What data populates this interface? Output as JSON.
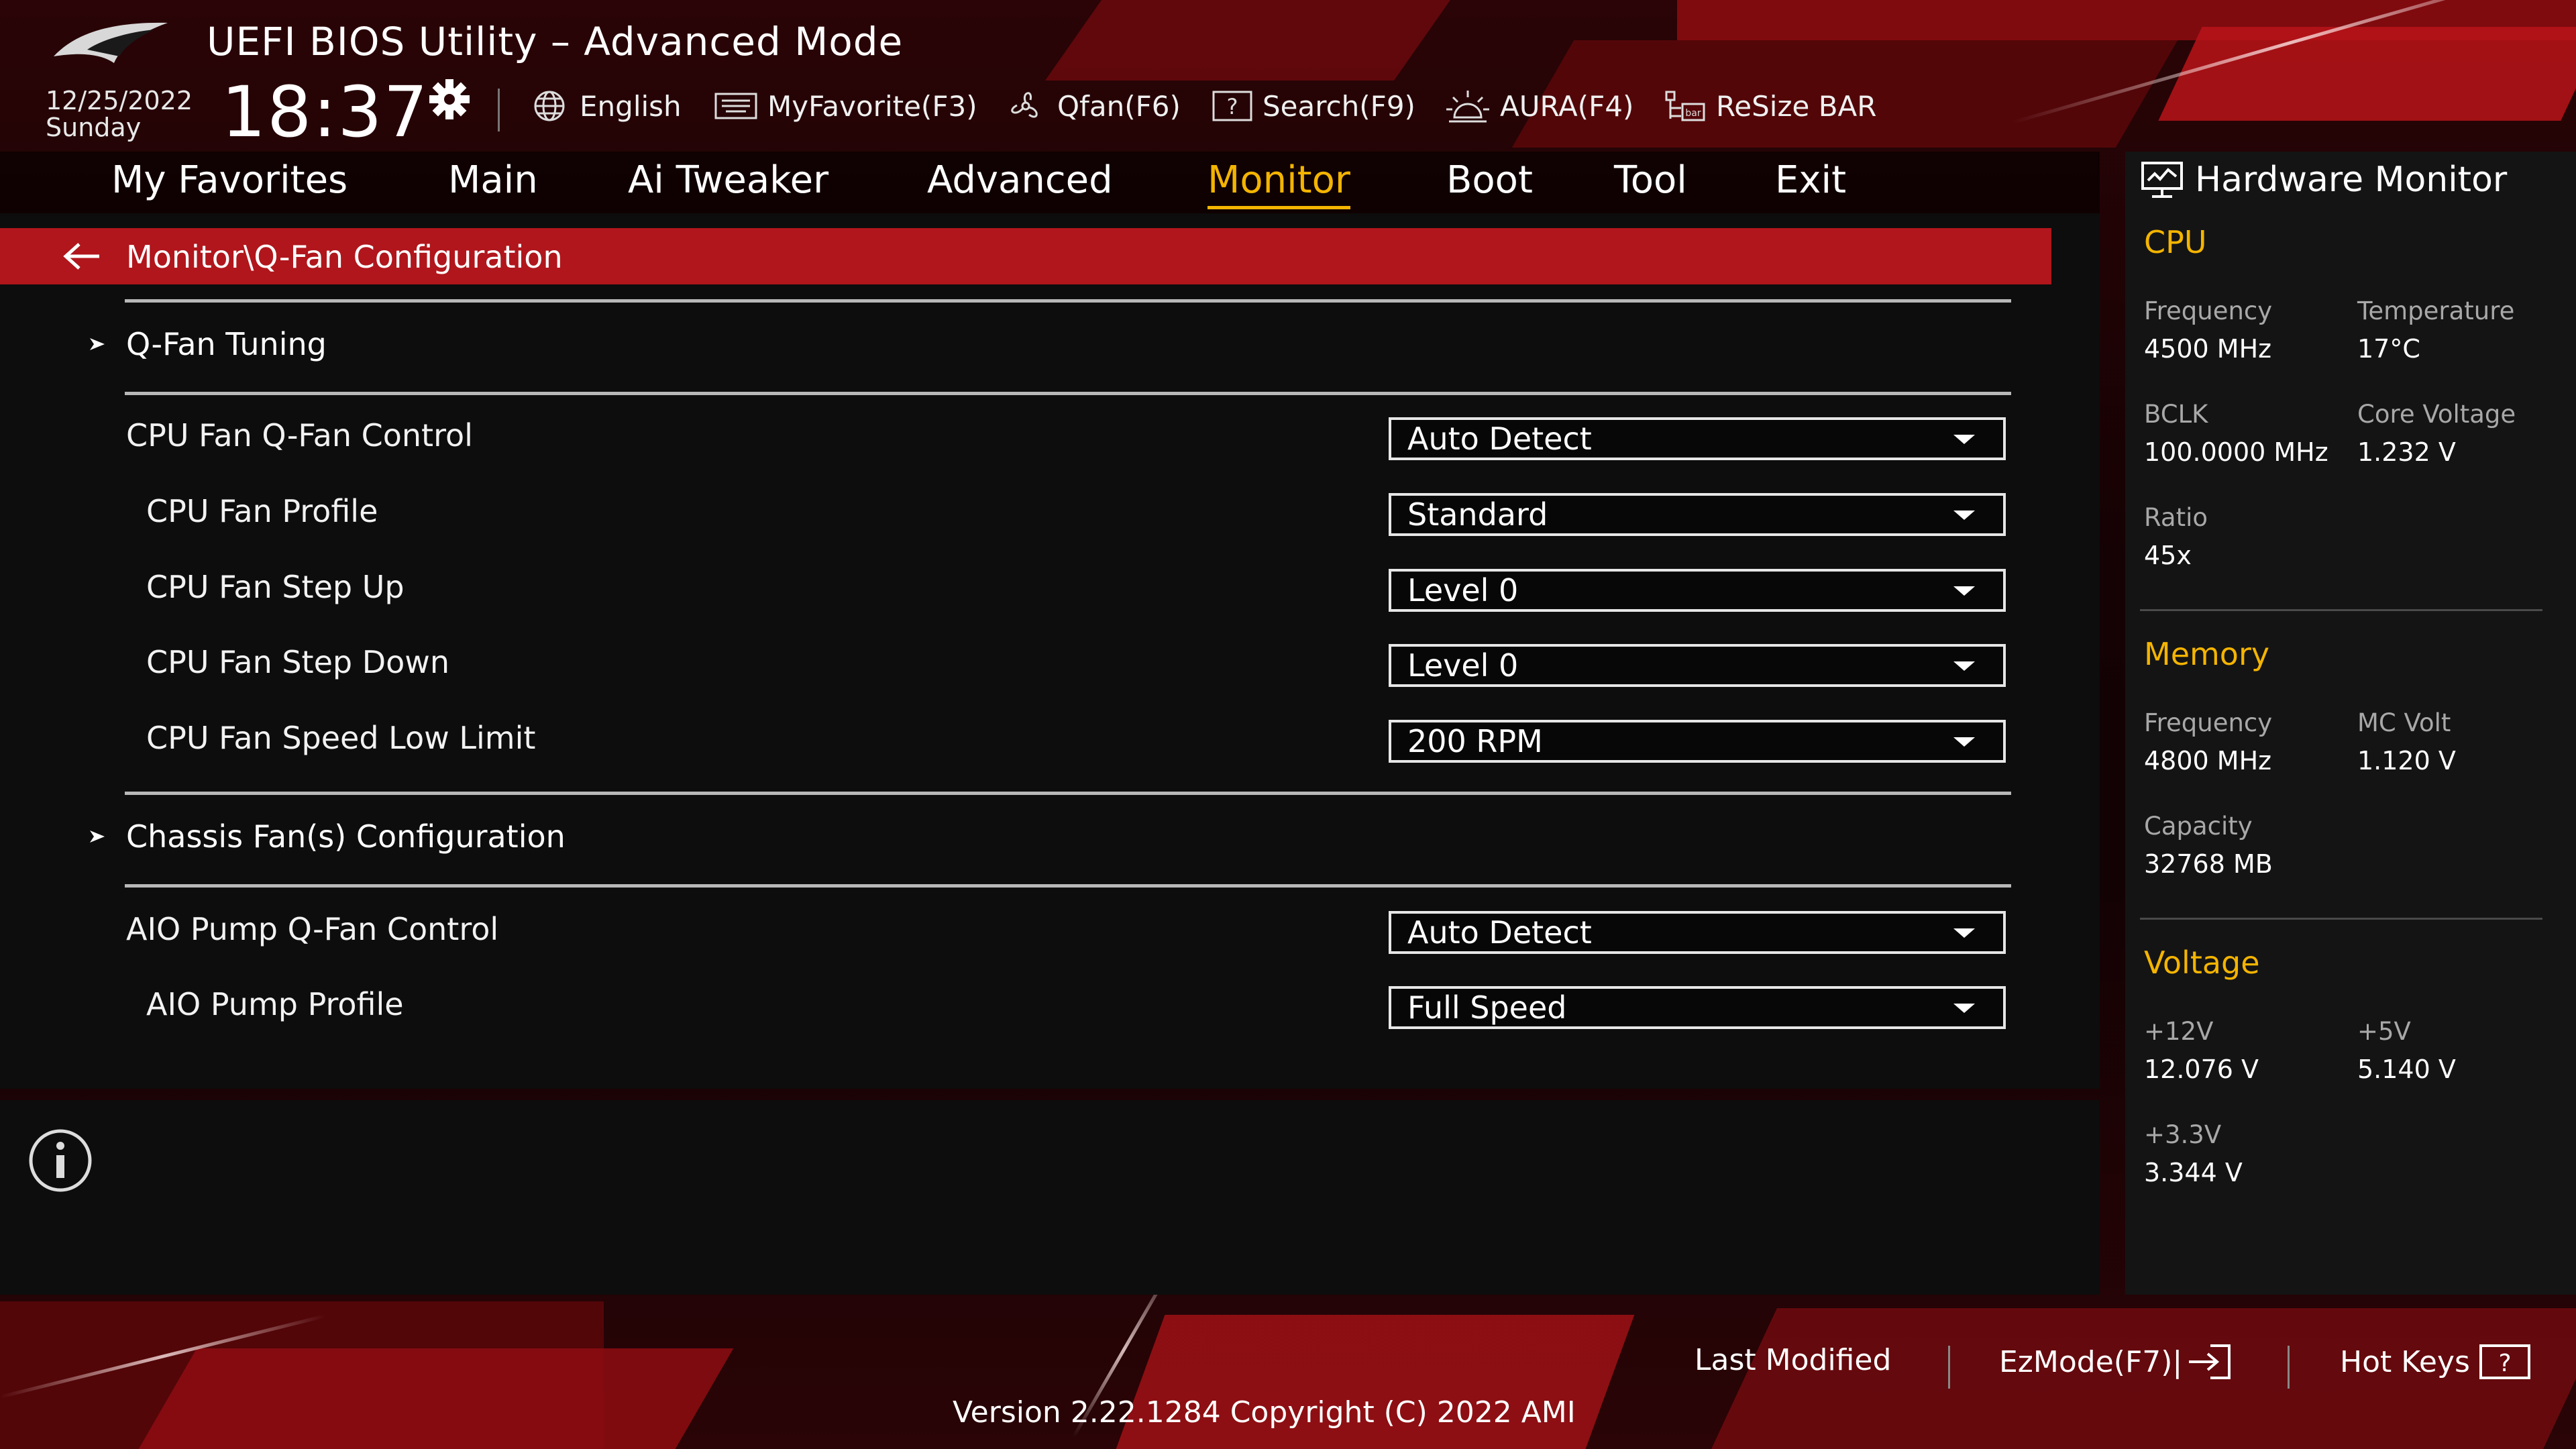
{
  "header": {
    "title": "UEFI BIOS Utility – Advanced Mode",
    "date": "12/25/2022",
    "day": "Sunday",
    "time": "18:37",
    "toolbar": [
      {
        "icon": "globe-icon",
        "label": "English"
      },
      {
        "icon": "keyboard-icon",
        "label": "MyFavorite(F3)"
      },
      {
        "icon": "fan-icon",
        "label": "Qfan(F6)"
      },
      {
        "icon": "help-icon",
        "label": "Search(F9)"
      },
      {
        "icon": "aura-icon",
        "label": "AURA(F4)"
      },
      {
        "icon": "resize-bar-icon",
        "label": "ReSize BAR"
      }
    ]
  },
  "nav": {
    "tabs": [
      "My Favorites",
      "Main",
      "Ai Tweaker",
      "Advanced",
      "Monitor",
      "Boot",
      "Tool",
      "Exit"
    ],
    "active": "Monitor"
  },
  "breadcrumb": "Monitor\\Q-Fan Configuration",
  "settings": {
    "qfan_tuning": "Q-Fan Tuning",
    "cpu_fan_control": {
      "label": "CPU Fan Q-Fan Control",
      "value": "Auto Detect"
    },
    "cpu_fan_profile": {
      "label": "CPU Fan Profile",
      "value": "Standard"
    },
    "cpu_fan_step_up": {
      "label": "CPU Fan Step Up",
      "value": "Level 0"
    },
    "cpu_fan_step_down": {
      "label": "CPU Fan Step Down",
      "value": "Level 0"
    },
    "cpu_fan_low_limit": {
      "label": "CPU Fan Speed Low Limit",
      "value": "200 RPM"
    },
    "chassis_fans": "Chassis Fan(s) Configuration",
    "aio_pump_control": {
      "label": "AIO Pump Q-Fan Control",
      "value": "Auto Detect"
    },
    "aio_pump_profile": {
      "label": "AIO Pump Profile",
      "value": "Full Speed"
    }
  },
  "hardware_monitor": {
    "title": "Hardware Monitor",
    "cpu": {
      "title": "CPU",
      "frequency_label": "Frequency",
      "frequency": "4500 MHz",
      "temperature_label": "Temperature",
      "temperature": "17°C",
      "bclk_label": "BCLK",
      "bclk": "100.0000 MHz",
      "core_voltage_label": "Core Voltage",
      "core_voltage": "1.232 V",
      "ratio_label": "Ratio",
      "ratio": "45x"
    },
    "memory": {
      "title": "Memory",
      "frequency_label": "Frequency",
      "frequency": "4800 MHz",
      "mc_volt_label": "MC Volt",
      "mc_volt": "1.120 V",
      "capacity_label": "Capacity",
      "capacity": "32768 MB"
    },
    "voltage": {
      "title": "Voltage",
      "v12_label": "+12V",
      "v12": "12.076 V",
      "v5_label": "+5V",
      "v5": "5.140 V",
      "v33_label": "+3.3V",
      "v33": "3.344 V"
    }
  },
  "footer": {
    "last_modified": "Last Modified",
    "ezmode": "EzMode(F7)|",
    "hot_keys": "Hot Keys",
    "version": "Version 2.22.1284 Copyright (C) 2022 AMI"
  },
  "colors": {
    "accent": "#f4b400",
    "breadcrumb_bg": "#b0161c",
    "panel_bg": "#0d0d0d"
  }
}
